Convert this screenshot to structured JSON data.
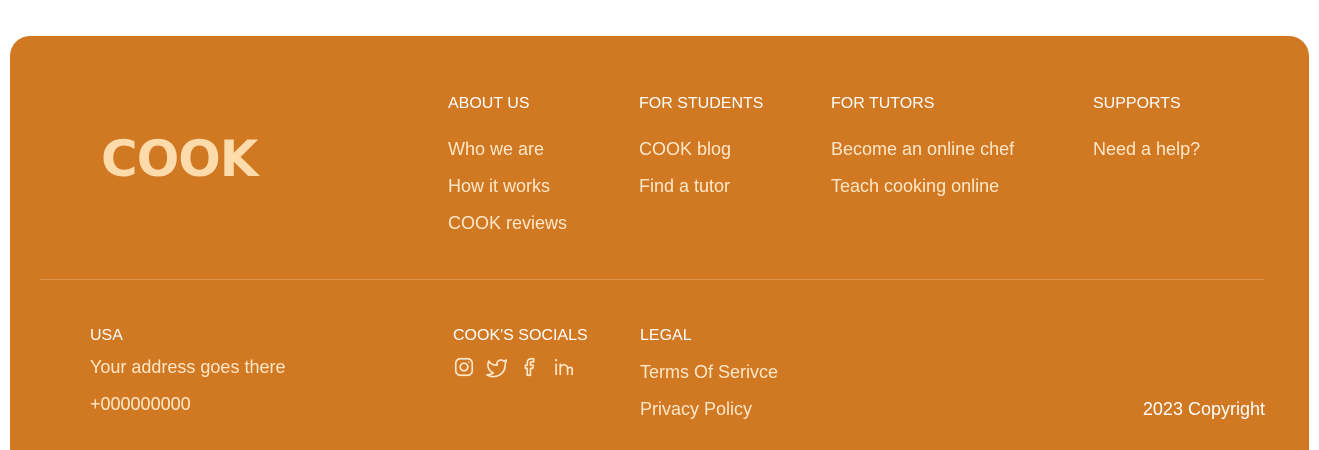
{
  "brand": {
    "logo_text": "COOK"
  },
  "columns": [
    {
      "title": "ABOUT US",
      "links": [
        "Who we are",
        "How it works",
        "COOK reviews"
      ]
    },
    {
      "title": "FOR STUDENTS",
      "links": [
        "COOK blog",
        "Find a tutor"
      ]
    },
    {
      "title": "FOR TUTORS",
      "links": [
        "Become an online chef",
        "Teach cooking online"
      ]
    },
    {
      "title": "SUPPORTS",
      "links": [
        "Need a help?"
      ]
    }
  ],
  "contact": {
    "country": "USA",
    "address": "Your address goes there",
    "phone": "+000000000"
  },
  "socials": {
    "title": "COOK'S SOCIALS",
    "icons": [
      "instagram-icon",
      "twitter-icon",
      "facebook-icon",
      "linkedin-icon"
    ]
  },
  "legal": {
    "title": "LEGAL",
    "links": [
      "Terms Of Serivce",
      "Privacy Policy"
    ]
  },
  "copyright": "2023 Copyright",
  "colors": {
    "footer_bg": "#d17823",
    "logo": "#fddbaa",
    "text": "#ffe8c8",
    "heading": "#ffffff"
  }
}
